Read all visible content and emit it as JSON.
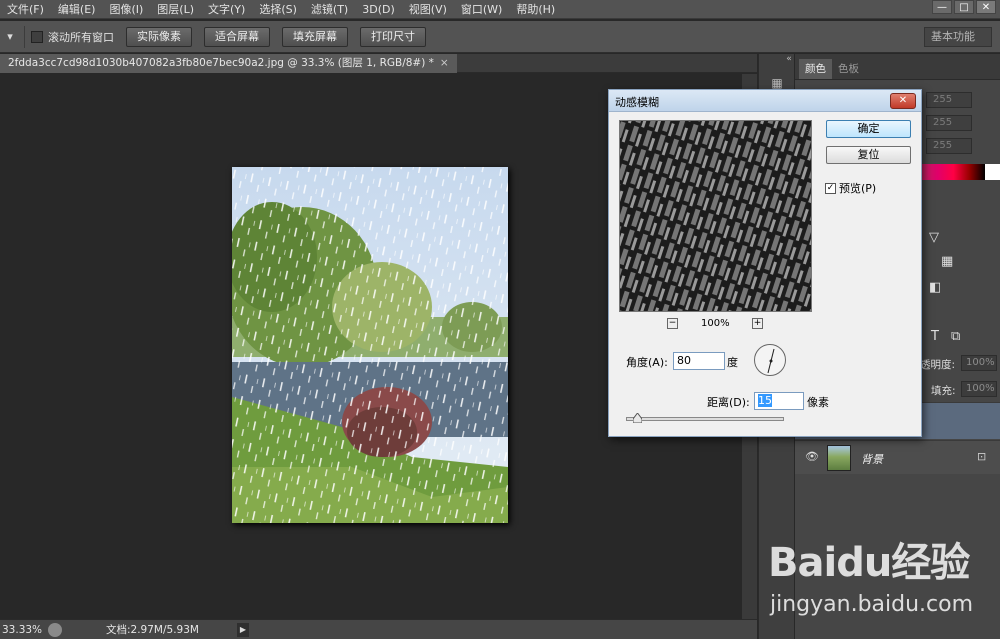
{
  "menubar": {
    "items": [
      "文件(F)",
      "编辑(E)",
      "图像(I)",
      "图层(L)",
      "文字(Y)",
      "选择(S)",
      "滤镜(T)",
      "3D(D)",
      "视图(V)",
      "窗口(W)",
      "帮助(H)"
    ],
    "minimize": "—",
    "restore": "□",
    "close": "✕"
  },
  "optbar": {
    "scroll_all_label": "滚动所有窗口",
    "btn_actual_pixels": "实际像素",
    "btn_fit_screen": "适合屏幕",
    "btn_fill_screen": "填充屏幕",
    "btn_print_size": "打印尺寸",
    "workspace": "基本功能"
  },
  "document": {
    "tab_title": "2fdda3cc7cd98d1030b407082a3fb80e7bec90a2.jpg @ 33.3% (图层 1, RGB/8#) *",
    "tab_close": "×"
  },
  "status": {
    "zoom": "33.33%",
    "doc_info": "文档:2.97M/5.93M",
    "arrow": "▶"
  },
  "color_panel": {
    "tab_color": "颜色",
    "tab_swatches": "色板",
    "r": "255",
    "g": "255",
    "b": "255"
  },
  "layers_panel": {
    "opacity_label": "透明度:",
    "opacity_value": "100%",
    "fill_label": "填充:",
    "fill_value": "100%",
    "background_layer_name": "背景",
    "lock_icon": "🔒"
  },
  "dialog": {
    "title": "动感模糊",
    "close": "✕",
    "ok_label": "确定",
    "reset_label": "复位",
    "preview_label": "预览(P)",
    "preview_checked": "✓",
    "zoom_minus": "−",
    "zoom_plus": "+",
    "zoom_percent": "100%",
    "angle_label": "角度(A):",
    "angle_value": "80",
    "angle_unit": "度",
    "distance_label": "距离(D):",
    "distance_value": "15",
    "distance_unit": "像素"
  },
  "watermark": {
    "logo": "Baidu经验",
    "url": "jingyan.baidu.com"
  },
  "colors": {
    "ps_dark": "#282828",
    "ps_panel": "#464646",
    "dialog_bg": "#f0f0f0",
    "selection_blue": "#3399ff"
  }
}
